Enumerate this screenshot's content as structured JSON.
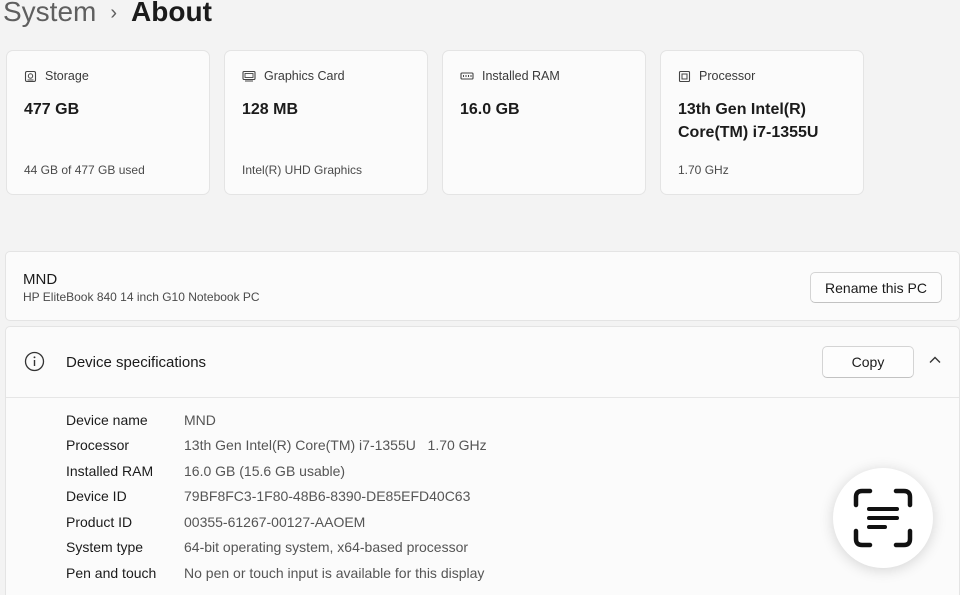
{
  "breadcrumb": {
    "parent": "System",
    "current": "About"
  },
  "cards": [
    {
      "icon": "storage-icon",
      "label": "Storage",
      "value": "477 GB",
      "sub": "44 GB of 477 GB used"
    },
    {
      "icon": "graphics-card-icon",
      "label": "Graphics Card",
      "value": "128 MB",
      "sub": "Intel(R) UHD Graphics"
    },
    {
      "icon": "memory-icon",
      "label": "Installed RAM",
      "value": "16.0 GB",
      "sub": ""
    },
    {
      "icon": "processor-icon",
      "label": "Processor",
      "value": "13th Gen Intel(R) Core(TM) i7-1355U",
      "sub": "1.70 GHz"
    }
  ],
  "pc": {
    "name": "MND",
    "model": "HP EliteBook 840 14 inch G10 Notebook PC",
    "rename_label": "Rename this PC"
  },
  "specs": {
    "title": "Device specifications",
    "copy_label": "Copy",
    "rows": [
      {
        "label": "Device name",
        "value": "MND"
      },
      {
        "label": "Processor",
        "value": "13th Gen Intel(R) Core(TM) i7-1355U   1.70 GHz"
      },
      {
        "label": "Installed RAM",
        "value": "16.0 GB (15.6 GB usable)"
      },
      {
        "label": "Device ID",
        "value": "79BF8FC3-1F80-48B6-8390-DE85EFD40C63"
      },
      {
        "label": "Product ID",
        "value": "00355-61267-00127-AAOEM"
      },
      {
        "label": "System type",
        "value": "64-bit operating system, x64-based processor"
      },
      {
        "label": "Pen and touch",
        "value": "No pen or touch input is available for this display"
      }
    ]
  },
  "icons": {
    "info": "info-icon",
    "chevron": "chevron-up-icon",
    "fab": "scan-text-icon"
  },
  "colors": {
    "background": "#f3f3f3",
    "card": "#fbfbfb",
    "border": "#e4e4e4"
  }
}
